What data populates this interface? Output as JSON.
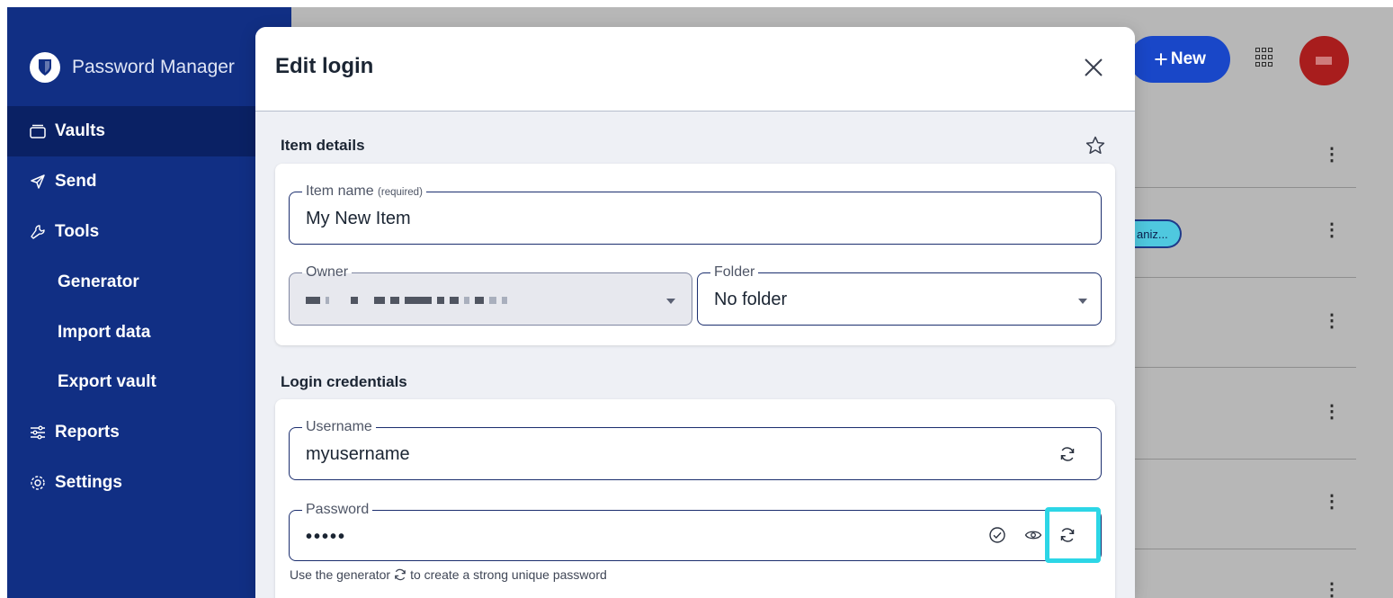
{
  "app": {
    "brand": "Password Manager"
  },
  "sidebar": {
    "items": [
      {
        "label": "Vaults",
        "icon": "vault-icon",
        "active": true
      },
      {
        "label": "Send",
        "icon": "send-icon"
      },
      {
        "label": "Tools",
        "icon": "wrench-icon",
        "expanded": true
      },
      {
        "label": "Generator",
        "sub": true
      },
      {
        "label": "Import data",
        "sub": true
      },
      {
        "label": "Export vault",
        "sub": true
      },
      {
        "label": "Reports",
        "icon": "sliders-icon"
      },
      {
        "label": "Settings",
        "icon": "gear-icon"
      }
    ]
  },
  "header": {
    "new_button": "New",
    "apps_icon": "grid-apps-icon",
    "avatar_color": "#a81d1d"
  },
  "background_list": {
    "badge_text": "aniz..."
  },
  "modal": {
    "title": "Edit login",
    "item_details": {
      "section_title": "Item details",
      "item_name_label": "Item name",
      "item_name_hint": "(required)",
      "item_name_value": "My New Item",
      "owner_label": "Owner",
      "folder_label": "Folder",
      "folder_value": "No folder"
    },
    "login_credentials": {
      "section_title": "Login credentials",
      "username_label": "Username",
      "username_value": "myusername",
      "password_label": "Password",
      "password_value": "•••••",
      "hint_prefix": "Use the generator",
      "hint_suffix": "to create a strong unique password"
    }
  },
  "colors": {
    "sidebar_bg": "#112f84",
    "sidebar_active": "#0a2164",
    "primary": "#1947c8",
    "highlight": "#2cd6e6",
    "backdrop": "#b7b7b7"
  }
}
